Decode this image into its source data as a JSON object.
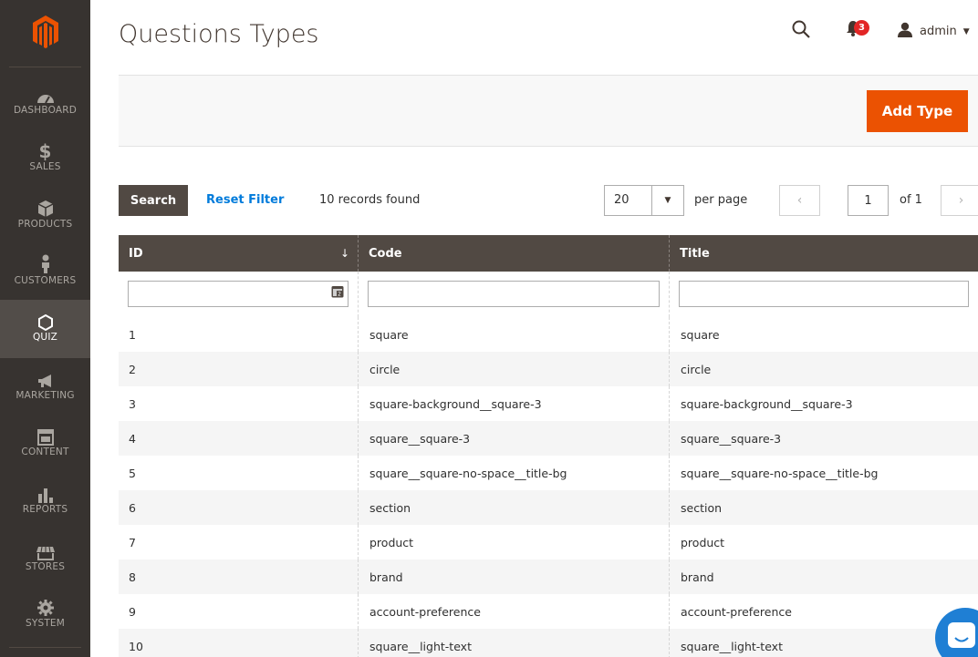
{
  "brand": {
    "accent": "#eb5202",
    "sidebar_bg": "#373330",
    "link": "#007bdb"
  },
  "sidebar": {
    "logo": "magento-logo-icon",
    "items": [
      {
        "label": "DASHBOARD",
        "icon": "speedometer-icon"
      },
      {
        "label": "SALES",
        "icon": "dollar-icon"
      },
      {
        "label": "PRODUCTS",
        "icon": "cube-icon"
      },
      {
        "label": "CUSTOMERS",
        "icon": "person-icon"
      },
      {
        "label": "QUIZ",
        "icon": "hexagon-icon",
        "active": true
      },
      {
        "label": "MARKETING",
        "icon": "megaphone-icon"
      },
      {
        "label": "CONTENT",
        "icon": "layout-icon"
      },
      {
        "label": "REPORTS",
        "icon": "bar-chart-icon"
      },
      {
        "label": "STORES",
        "icon": "storefront-icon"
      },
      {
        "label": "SYSTEM",
        "icon": "gear-icon"
      }
    ]
  },
  "header": {
    "title": "Questions Types",
    "notifications_count": "3",
    "user": "admin"
  },
  "actions": {
    "add_label": "Add Type"
  },
  "toolbar": {
    "search_label": "Search",
    "reset_label": "Reset Filter",
    "records": "10 records found",
    "per_page_value": "20",
    "per_page_label": "per page",
    "page_value": "1",
    "page_of": "of 1",
    "prev": "‹",
    "next": "›"
  },
  "grid": {
    "columns": [
      "ID",
      "Code",
      "Title"
    ],
    "sort_indicator": "↓",
    "rows": [
      {
        "id": "1",
        "code": "square",
        "title": "square"
      },
      {
        "id": "2",
        "code": "circle",
        "title": "circle"
      },
      {
        "id": "3",
        "code": "square-background__square-3",
        "title": "square-background__square-3"
      },
      {
        "id": "4",
        "code": "square__square-3",
        "title": "square__square-3"
      },
      {
        "id": "5",
        "code": "square__square-no-space__title-bg",
        "title": "square__square-no-space__title-bg"
      },
      {
        "id": "6",
        "code": "section",
        "title": "section"
      },
      {
        "id": "7",
        "code": "product",
        "title": "product"
      },
      {
        "id": "8",
        "code": "brand",
        "title": "brand"
      },
      {
        "id": "9",
        "code": "account-preference",
        "title": "account-preference"
      },
      {
        "id": "10",
        "code": "square__light-text",
        "title": "square__light-text"
      }
    ]
  }
}
